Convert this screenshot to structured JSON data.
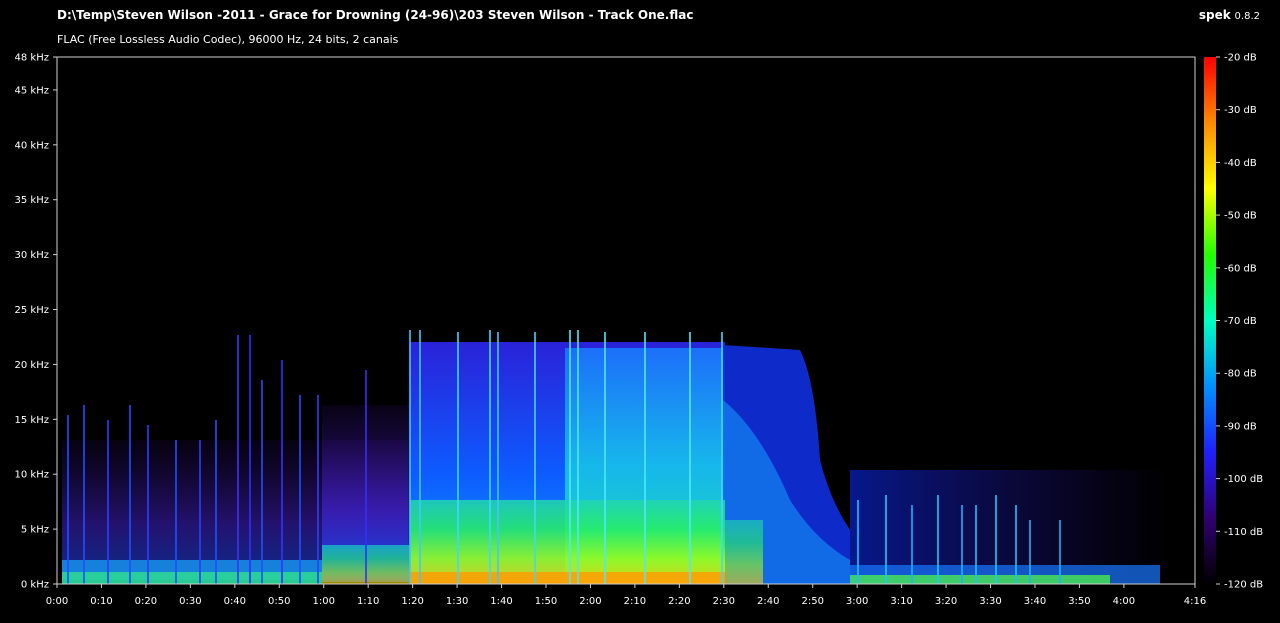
{
  "app": {
    "name": "spek",
    "version": "0.8.2"
  },
  "file": {
    "path": "D:\\Temp\\Steven Wilson -2011 - Grace for Drowning (24-96)\\203 Steven Wilson - Track One.flac",
    "info": "FLAC (Free Lossless Audio Codec), 96000 Hz, 24 bits, 2 canais"
  },
  "spectrogram": {
    "freq_labels": [
      "0 kHz",
      "5 kHz",
      "10 kHz",
      "15 kHz",
      "20 kHz",
      "25 kHz",
      "30 kHz",
      "35 kHz",
      "40 kHz",
      "45 kHz",
      "48 kHz"
    ],
    "freq_values": [
      0,
      5,
      10,
      15,
      20,
      25,
      30,
      35,
      40,
      45,
      48
    ],
    "freq_max": 48,
    "time_labels": [
      "0:00",
      "0:10",
      "0:20",
      "0:30",
      "0:40",
      "0:50",
      "1:00",
      "1:10",
      "1:20",
      "1:30",
      "1:40",
      "1:50",
      "2:00",
      "2:10",
      "2:20",
      "2:30",
      "2:40",
      "2:50",
      "3:00",
      "3:10",
      "3:20",
      "3:30",
      "3:40",
      "3:50",
      "4:00",
      "4:16"
    ],
    "time_values": [
      0,
      10,
      20,
      30,
      40,
      50,
      60,
      70,
      80,
      90,
      100,
      110,
      120,
      130,
      140,
      150,
      160,
      170,
      180,
      190,
      200,
      210,
      220,
      230,
      240,
      256
    ],
    "duration_s": 256
  },
  "colorbar": {
    "labels": [
      "-20 dB",
      "-30 dB",
      "-40 dB",
      "-50 dB",
      "-60 dB",
      "-70 dB",
      "-80 dB",
      "-90 dB",
      "-100 dB",
      "-110 dB",
      "-120 dB"
    ],
    "values": [
      -20,
      -30,
      -40,
      -50,
      -60,
      -70,
      -80,
      -90,
      -100,
      -110,
      -120
    ],
    "gradient": [
      "#ff0000",
      "#ff8a00",
      "#ffff00",
      "#22ff00",
      "#00ffc0",
      "#0090ff",
      "#2020ff",
      "#300070",
      "#000000"
    ]
  }
}
